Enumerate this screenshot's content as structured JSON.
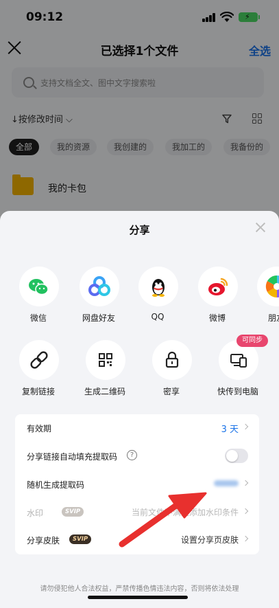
{
  "status_bar": {
    "time": "09:12"
  },
  "nav": {
    "title": "已选择1个文件",
    "select_all": "全选"
  },
  "search": {
    "placeholder": "支持文档全文、图中文字搜索啦"
  },
  "sort": {
    "label": "↓按修改时间 ⌵"
  },
  "chips": [
    "全部",
    "我的资源",
    "我创建的",
    "我加工的",
    "我备份的"
  ],
  "folder": {
    "name": "我的卡包"
  },
  "sheet": {
    "title": "分享",
    "apps": [
      {
        "label": "微信",
        "icon": "wechat-icon"
      },
      {
        "label": "网盘好友",
        "icon": "netdisk-friend-icon"
      },
      {
        "label": "QQ",
        "icon": "qq-icon"
      },
      {
        "label": "微博",
        "icon": "weibo-icon"
      },
      {
        "label": "朋友",
        "icon": "moments-icon"
      }
    ],
    "actions": [
      {
        "label": "复制链接",
        "icon": "link-icon"
      },
      {
        "label": "生成二维码",
        "icon": "qrcode-icon"
      },
      {
        "label": "密享",
        "icon": "lock-icon"
      },
      {
        "label": "快传到电脑",
        "icon": "devices-icon"
      }
    ],
    "sync_badge": "可同步",
    "settings": {
      "validity_label": "有效期",
      "validity_value": "3 天",
      "autofill_label": "分享链接自动填充提取码",
      "random_code_label": "随机生成提取码",
      "watermark_label": "水印",
      "watermark_badge": "SVIP",
      "watermark_value": "当前文件不满足添加水印条件",
      "skin_label": "分享皮肤",
      "skin_badge": "SVIP",
      "skin_value": "设置分享页皮肤"
    },
    "footer": "请勿侵犯他人合法权益，严禁传播色情违法内容，否则将依法处理"
  },
  "colors": {
    "accent": "#1a73e8",
    "svip_bg": "#3a2f25",
    "sync_badge": "#e8466e",
    "annotation_arrow": "#e8302e"
  }
}
